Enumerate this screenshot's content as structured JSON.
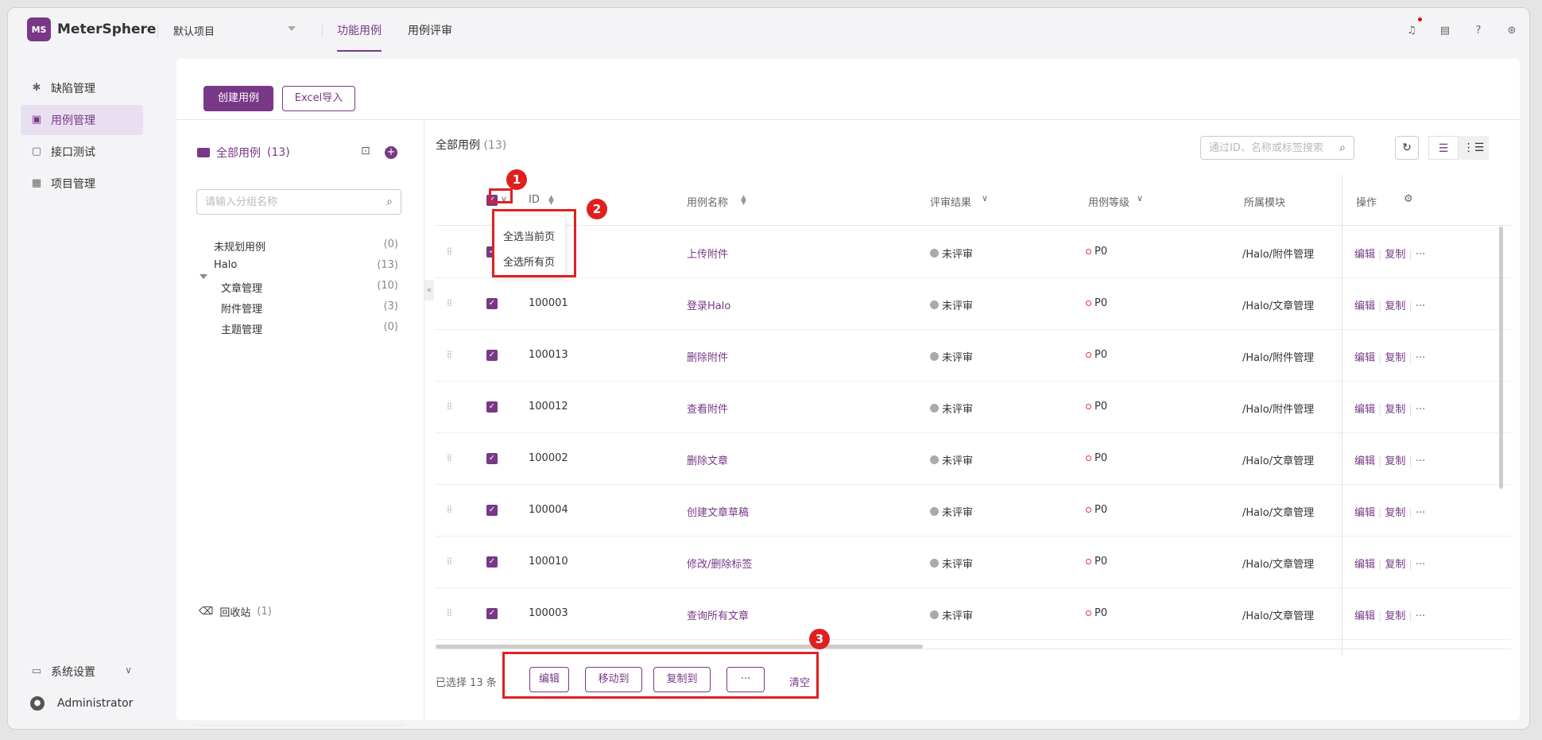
{
  "topbar": {
    "logo": "MeterSphere",
    "project": "默认项目",
    "tabs": [
      "功能用例",
      "用例评审"
    ]
  },
  "sidebar": {
    "items": [
      {
        "label": "缺陷管理",
        "icon": "bug-icon"
      },
      {
        "label": "用例管理",
        "icon": "case-icon"
      },
      {
        "label": "接口测试",
        "icon": "api-icon"
      },
      {
        "label": "项目管理",
        "icon": "project-icon"
      }
    ],
    "settings": "系统设置",
    "user": "Administrator"
  },
  "toolbar": {
    "create": "创建用例",
    "import": "Excel导入"
  },
  "tree": {
    "title": "全部用例",
    "title_count": "(13)",
    "search_placeholder": "请输入分组名称",
    "nodes": [
      {
        "label": "未规划用例",
        "count": "(0)"
      },
      {
        "label": "Halo",
        "count": "(13)"
      },
      {
        "label": "文章管理",
        "count": "(10)"
      },
      {
        "label": "附件管理",
        "count": "(3)"
      },
      {
        "label": "主题管理",
        "count": "(0)"
      }
    ],
    "recycle": "回收站",
    "recycle_count": "(1)"
  },
  "content": {
    "title": "全部用例",
    "count": "(13)",
    "search_placeholder": "通过ID、名称或标签搜索"
  },
  "table": {
    "headers": {
      "id": "ID",
      "name": "用例名称",
      "review": "评审结果",
      "level": "用例等级",
      "module": "所属模块",
      "ops": "操作"
    },
    "rows": [
      {
        "id": "",
        "name": "上传附件",
        "review": "未评审",
        "level": "P0",
        "module": "/Halo/附件管理"
      },
      {
        "id": "100001",
        "name": "登录Halo",
        "review": "未评审",
        "level": "P0",
        "module": "/Halo/文章管理"
      },
      {
        "id": "100013",
        "name": "删除附件",
        "review": "未评审",
        "level": "P0",
        "module": "/Halo/附件管理"
      },
      {
        "id": "100012",
        "name": "查看附件",
        "review": "未评审",
        "level": "P0",
        "module": "/Halo/附件管理"
      },
      {
        "id": "100002",
        "name": "删除文章",
        "review": "未评审",
        "level": "P0",
        "module": "/Halo/文章管理"
      },
      {
        "id": "100004",
        "name": "创建文章草稿",
        "review": "未评审",
        "level": "P0",
        "module": "/Halo/文章管理"
      },
      {
        "id": "100010",
        "name": "修改/删除标签",
        "review": "未评审",
        "level": "P0",
        "module": "/Halo/文章管理"
      },
      {
        "id": "100003",
        "name": "查询所有文章",
        "review": "未评审",
        "level": "P0",
        "module": "/Halo/文章管理"
      }
    ],
    "op_edit": "编辑",
    "op_copy": "复制",
    "op_more": "···"
  },
  "dropdown": {
    "items": [
      "全选当前页",
      "全选所有页"
    ]
  },
  "batch": {
    "selected": "已选择 13 条",
    "edit": "编辑",
    "move": "移动到",
    "copy": "复制到",
    "more": "···",
    "clear": "清空"
  },
  "annotations": [
    "1",
    "2",
    "3"
  ],
  "colors": {
    "accent": "#783887",
    "annotation": "#e02020"
  }
}
